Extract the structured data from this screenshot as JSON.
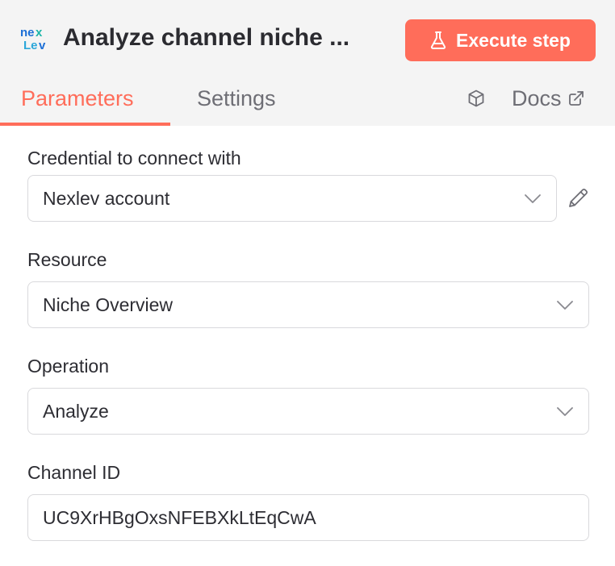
{
  "header": {
    "title": "Analyze channel niche ...",
    "logo_icon": "nexlev-logo",
    "execute_button": {
      "label": "Execute step",
      "icon": "flask-icon",
      "color": "#ff6d5a"
    }
  },
  "tabs": [
    {
      "label": "Parameters",
      "active": true
    },
    {
      "label": "Settings",
      "active": false
    }
  ],
  "docs": {
    "label": "Docs",
    "icon": "external-link-icon",
    "node_icon": "cube-icon"
  },
  "fields": {
    "credential": {
      "label": "Credential to connect with",
      "value": "Nexlev account",
      "icon": "chevron-down-icon",
      "edit_icon": "pencil-icon"
    },
    "resource": {
      "label": "Resource",
      "value": "Niche Overview",
      "icon": "chevron-down-icon"
    },
    "operation": {
      "label": "Operation",
      "value": "Analyze",
      "icon": "chevron-down-icon"
    },
    "channel_id": {
      "label": "Channel ID",
      "value": "UC9XrHBgOxsNFEBXkLtEqCwA"
    }
  },
  "colors": {
    "accent": "#ff6d5a",
    "header_bg": "#f4f4f4",
    "border": "#d9d9dc",
    "text": "#2d2d33",
    "muted": "#6e6e75"
  }
}
